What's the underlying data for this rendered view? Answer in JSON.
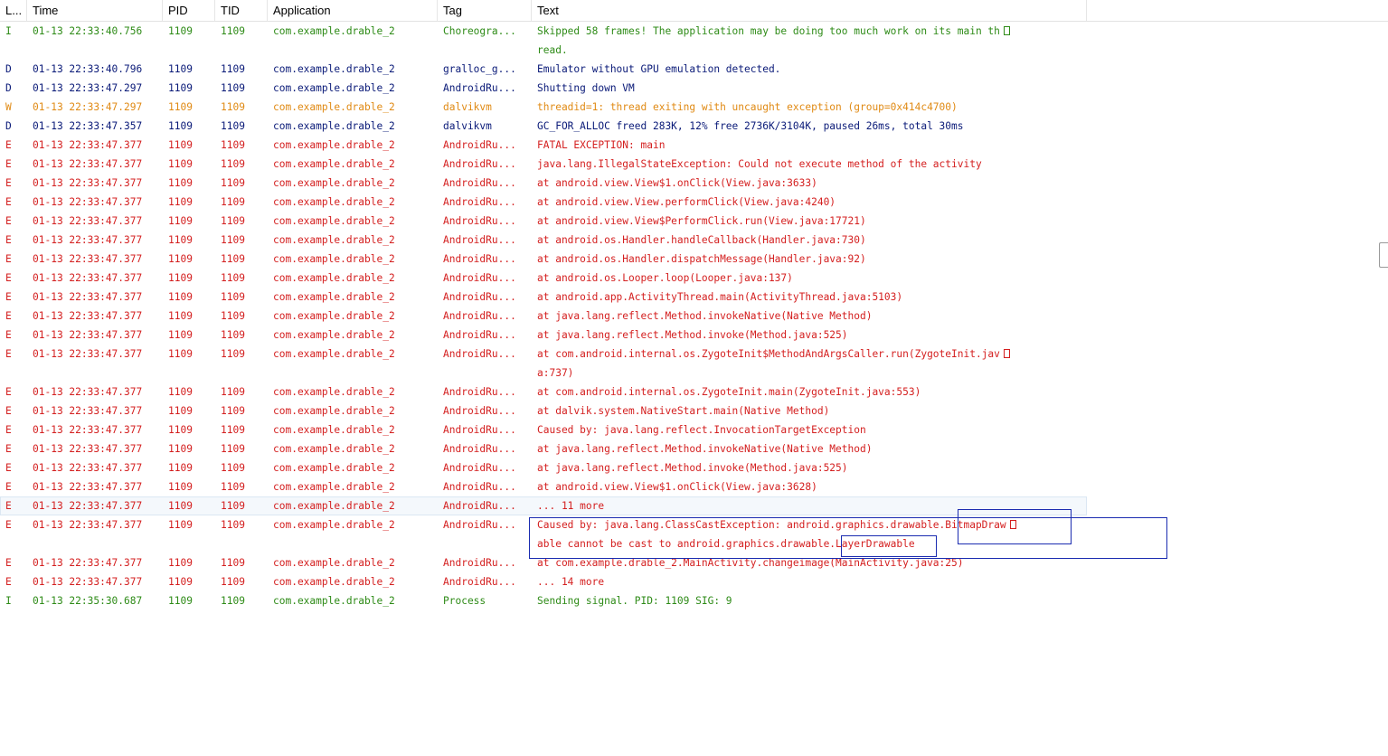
{
  "columns": {
    "level": "L...",
    "time": "Time",
    "pid": "PID",
    "tid": "TID",
    "application": "Application",
    "tag": "Tag",
    "text": "Text"
  },
  "level_colors": {
    "I": "#2e8b17",
    "D": "#0a1a78",
    "W": "#e08a14",
    "E": "#d41f1f"
  },
  "wrap_marker_icon": "wrap-continuation-box-icon",
  "rows": [
    {
      "level": "I",
      "time": "01-13 22:33:40.756",
      "pid": "1109",
      "tid": "1109",
      "app": "com.example.drable_2",
      "tag": "Choreogra...",
      "text": "Skipped 58 frames!  The application may be doing too much work on its main th",
      "text2": "read."
    },
    {
      "level": "D",
      "time": "01-13 22:33:40.796",
      "pid": "1109",
      "tid": "1109",
      "app": "com.example.drable_2",
      "tag": "gralloc_g...",
      "text": "Emulator without GPU emulation detected."
    },
    {
      "level": "D",
      "time": "01-13 22:33:47.297",
      "pid": "1109",
      "tid": "1109",
      "app": "com.example.drable_2",
      "tag": "AndroidRu...",
      "text": "Shutting down VM"
    },
    {
      "level": "W",
      "time": "01-13 22:33:47.297",
      "pid": "1109",
      "tid": "1109",
      "app": "com.example.drable_2",
      "tag": "dalvikvm",
      "text": "threadid=1: thread exiting with uncaught exception (group=0x414c4700)"
    },
    {
      "level": "D",
      "time": "01-13 22:33:47.357",
      "pid": "1109",
      "tid": "1109",
      "app": "com.example.drable_2",
      "tag": "dalvikvm",
      "text": "GC_FOR_ALLOC freed 283K, 12% free 2736K/3104K, paused 26ms, total 30ms"
    },
    {
      "level": "E",
      "time": "01-13 22:33:47.377",
      "pid": "1109",
      "tid": "1109",
      "app": "com.example.drable_2",
      "tag": "AndroidRu...",
      "text": "FATAL EXCEPTION: main"
    },
    {
      "level": "E",
      "time": "01-13 22:33:47.377",
      "pid": "1109",
      "tid": "1109",
      "app": "com.example.drable_2",
      "tag": "AndroidRu...",
      "text": "java.lang.IllegalStateException: Could not execute method of the activity"
    },
    {
      "level": "E",
      "time": "01-13 22:33:47.377",
      "pid": "1109",
      "tid": "1109",
      "app": "com.example.drable_2",
      "tag": "AndroidRu...",
      "text": "at android.view.View$1.onClick(View.java:3633)"
    },
    {
      "level": "E",
      "time": "01-13 22:33:47.377",
      "pid": "1109",
      "tid": "1109",
      "app": "com.example.drable_2",
      "tag": "AndroidRu...",
      "text": "at android.view.View.performClick(View.java:4240)"
    },
    {
      "level": "E",
      "time": "01-13 22:33:47.377",
      "pid": "1109",
      "tid": "1109",
      "app": "com.example.drable_2",
      "tag": "AndroidRu...",
      "text": "at android.view.View$PerformClick.run(View.java:17721)"
    },
    {
      "level": "E",
      "time": "01-13 22:33:47.377",
      "pid": "1109",
      "tid": "1109",
      "app": "com.example.drable_2",
      "tag": "AndroidRu...",
      "text": "at android.os.Handler.handleCallback(Handler.java:730)"
    },
    {
      "level": "E",
      "time": "01-13 22:33:47.377",
      "pid": "1109",
      "tid": "1109",
      "app": "com.example.drable_2",
      "tag": "AndroidRu...",
      "text": "at android.os.Handler.dispatchMessage(Handler.java:92)"
    },
    {
      "level": "E",
      "time": "01-13 22:33:47.377",
      "pid": "1109",
      "tid": "1109",
      "app": "com.example.drable_2",
      "tag": "AndroidRu...",
      "text": "at android.os.Looper.loop(Looper.java:137)"
    },
    {
      "level": "E",
      "time": "01-13 22:33:47.377",
      "pid": "1109",
      "tid": "1109",
      "app": "com.example.drable_2",
      "tag": "AndroidRu...",
      "text": "at android.app.ActivityThread.main(ActivityThread.java:5103)"
    },
    {
      "level": "E",
      "time": "01-13 22:33:47.377",
      "pid": "1109",
      "tid": "1109",
      "app": "com.example.drable_2",
      "tag": "AndroidRu...",
      "text": "at java.lang.reflect.Method.invokeNative(Native Method)"
    },
    {
      "level": "E",
      "time": "01-13 22:33:47.377",
      "pid": "1109",
      "tid": "1109",
      "app": "com.example.drable_2",
      "tag": "AndroidRu...",
      "text": "at java.lang.reflect.Method.invoke(Method.java:525)"
    },
    {
      "level": "E",
      "time": "01-13 22:33:47.377",
      "pid": "1109",
      "tid": "1109",
      "app": "com.example.drable_2",
      "tag": "AndroidRu...",
      "text": "at com.android.internal.os.ZygoteInit$MethodAndArgsCaller.run(ZygoteInit.jav",
      "text2": "a:737)"
    },
    {
      "level": "E",
      "time": "01-13 22:33:47.377",
      "pid": "1109",
      "tid": "1109",
      "app": "com.example.drable_2",
      "tag": "AndroidRu...",
      "text": "at com.android.internal.os.ZygoteInit.main(ZygoteInit.java:553)"
    },
    {
      "level": "E",
      "time": "01-13 22:33:47.377",
      "pid": "1109",
      "tid": "1109",
      "app": "com.example.drable_2",
      "tag": "AndroidRu...",
      "text": "at dalvik.system.NativeStart.main(Native Method)"
    },
    {
      "level": "E",
      "time": "01-13 22:33:47.377",
      "pid": "1109",
      "tid": "1109",
      "app": "com.example.drable_2",
      "tag": "AndroidRu...",
      "text": "Caused by: java.lang.reflect.InvocationTargetException"
    },
    {
      "level": "E",
      "time": "01-13 22:33:47.377",
      "pid": "1109",
      "tid": "1109",
      "app": "com.example.drable_2",
      "tag": "AndroidRu...",
      "text": "at java.lang.reflect.Method.invokeNative(Native Method)"
    },
    {
      "level": "E",
      "time": "01-13 22:33:47.377",
      "pid": "1109",
      "tid": "1109",
      "app": "com.example.drable_2",
      "tag": "AndroidRu...",
      "text": "at java.lang.reflect.Method.invoke(Method.java:525)"
    },
    {
      "level": "E",
      "time": "01-13 22:33:47.377",
      "pid": "1109",
      "tid": "1109",
      "app": "com.example.drable_2",
      "tag": "AndroidRu...",
      "text": "at android.view.View$1.onClick(View.java:3628)"
    },
    {
      "level": "E",
      "time": "01-13 22:33:47.377",
      "pid": "1109",
      "tid": "1109",
      "app": "com.example.drable_2",
      "tag": "AndroidRu...",
      "text": "... 11 more",
      "selected": true
    },
    {
      "level": "E",
      "time": "01-13 22:33:47.377",
      "pid": "1109",
      "tid": "1109",
      "app": "com.example.drable_2",
      "tag": "AndroidRu...",
      "text": "Caused by: java.lang.ClassCastException: android.graphics.drawable.BitmapDraw",
      "text2": "able cannot be cast to android.graphics.drawable.LayerDrawable"
    },
    {
      "level": "E",
      "time": "01-13 22:33:47.377",
      "pid": "1109",
      "tid": "1109",
      "app": "com.example.drable_2",
      "tag": "AndroidRu...",
      "text": "at com.example.drable_2.MainActivity.changeimage(MainActivity.java:25)"
    },
    {
      "level": "E",
      "time": "01-13 22:33:47.377",
      "pid": "1109",
      "tid": "1109",
      "app": "com.example.drable_2",
      "tag": "AndroidRu...",
      "text": "... 14 more"
    },
    {
      "level": "I",
      "time": "01-13 22:35:30.687",
      "pid": "1109",
      "tid": "1109",
      "app": "com.example.drable_2",
      "tag": "Process",
      "text": "Sending signal. PID: 1109 SIG: 9"
    }
  ]
}
